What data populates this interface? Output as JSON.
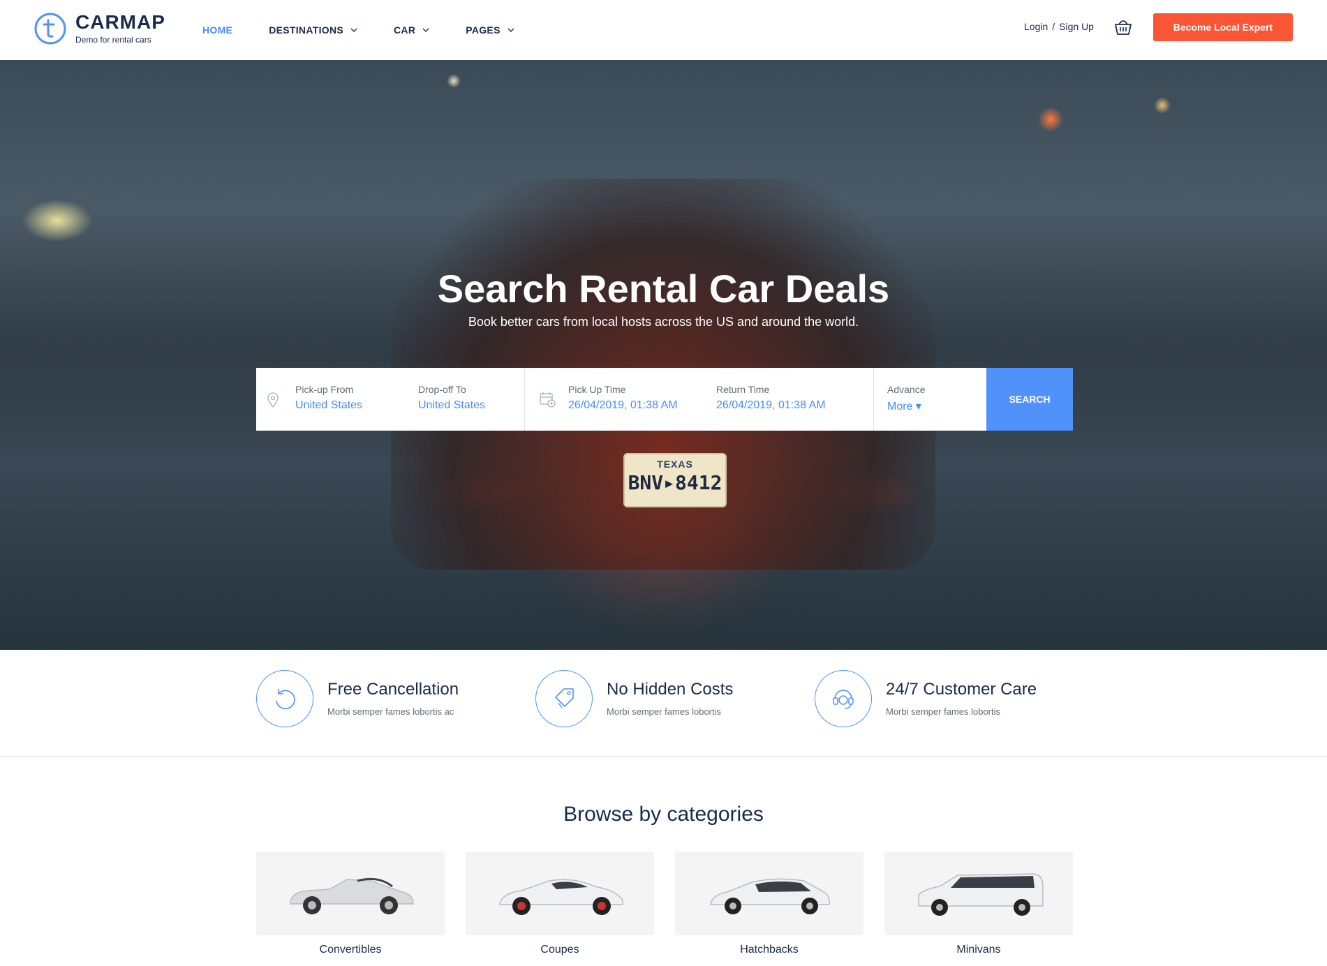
{
  "header": {
    "logo_title": "CARMAP",
    "logo_sub": "Demo for rental cars",
    "nav": [
      {
        "label": "HOME"
      },
      {
        "label": "DESTINATIONS"
      },
      {
        "label": "CAR"
      },
      {
        "label": "PAGES"
      }
    ],
    "login": "Login",
    "auth_sep": "/",
    "signup": "Sign Up",
    "cta": "Become Local Expert"
  },
  "hero": {
    "title": "Search Rental Car Deals",
    "subtitle": "Book better cars from local hosts across the US and around the world.",
    "plate_state": "TEXAS",
    "plate_number": "BNV▸8412"
  },
  "search": {
    "pickup_label": "Pick-up From",
    "pickup_value": "United States",
    "dropoff_label": "Drop-off To",
    "dropoff_value": "United States",
    "pickup_time_label": "Pick Up Time",
    "pickup_time_value": "26/04/2019, 01:38 AM",
    "return_time_label": "Return Time",
    "return_time_value": "26/04/2019, 01:38 AM",
    "advance_label": "Advance",
    "advance_value": "More ▾",
    "button": "SEARCH"
  },
  "features": [
    {
      "title": "Free Cancellation",
      "desc": "Morbi semper fames lobortis ac",
      "icon": "refresh-icon"
    },
    {
      "title": "No Hidden Costs",
      "desc": "Morbi semper fames lobortis",
      "icon": "tag-icon"
    },
    {
      "title": "24/7 Customer Care",
      "desc": "Morbi semper fames lobortis",
      "icon": "support-icon"
    }
  ],
  "categories": {
    "title": "Browse by categories",
    "items": [
      {
        "label": "Convertibles"
      },
      {
        "label": "Coupes"
      },
      {
        "label": "Hatchbacks"
      },
      {
        "label": "Minivans"
      }
    ]
  },
  "colors": {
    "accent": "#5191fa",
    "cta": "#fa5636",
    "text": "#1a2b49"
  }
}
